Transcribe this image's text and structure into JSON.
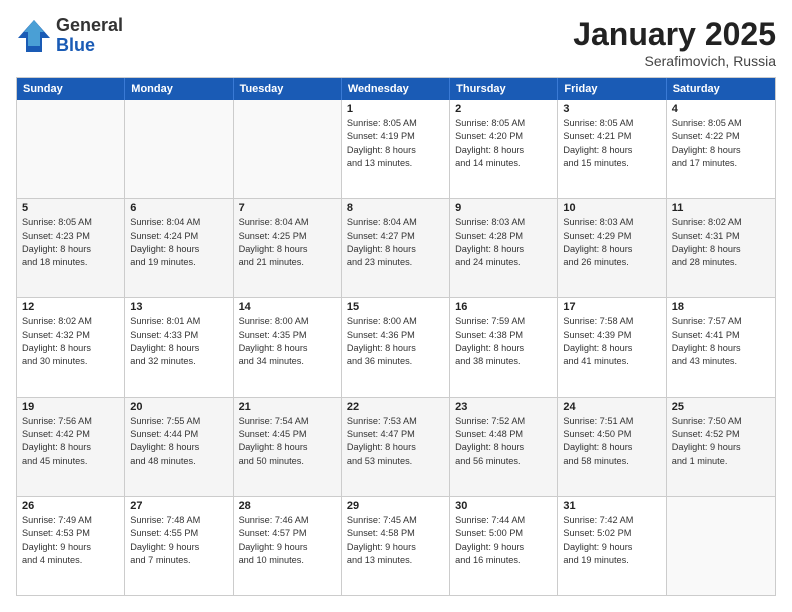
{
  "header": {
    "logo_general": "General",
    "logo_blue": "Blue",
    "month_title": "January 2025",
    "location": "Serafimovich, Russia"
  },
  "weekdays": [
    "Sunday",
    "Monday",
    "Tuesday",
    "Wednesday",
    "Thursday",
    "Friday",
    "Saturday"
  ],
  "rows": [
    [
      {
        "day": "",
        "text": "",
        "empty": true
      },
      {
        "day": "",
        "text": "",
        "empty": true
      },
      {
        "day": "",
        "text": "",
        "empty": true
      },
      {
        "day": "1",
        "text": "Sunrise: 8:05 AM\nSunset: 4:19 PM\nDaylight: 8 hours\nand 13 minutes."
      },
      {
        "day": "2",
        "text": "Sunrise: 8:05 AM\nSunset: 4:20 PM\nDaylight: 8 hours\nand 14 minutes."
      },
      {
        "day": "3",
        "text": "Sunrise: 8:05 AM\nSunset: 4:21 PM\nDaylight: 8 hours\nand 15 minutes."
      },
      {
        "day": "4",
        "text": "Sunrise: 8:05 AM\nSunset: 4:22 PM\nDaylight: 8 hours\nand 17 minutes."
      }
    ],
    [
      {
        "day": "5",
        "text": "Sunrise: 8:05 AM\nSunset: 4:23 PM\nDaylight: 8 hours\nand 18 minutes."
      },
      {
        "day": "6",
        "text": "Sunrise: 8:04 AM\nSunset: 4:24 PM\nDaylight: 8 hours\nand 19 minutes."
      },
      {
        "day": "7",
        "text": "Sunrise: 8:04 AM\nSunset: 4:25 PM\nDaylight: 8 hours\nand 21 minutes."
      },
      {
        "day": "8",
        "text": "Sunrise: 8:04 AM\nSunset: 4:27 PM\nDaylight: 8 hours\nand 23 minutes."
      },
      {
        "day": "9",
        "text": "Sunrise: 8:03 AM\nSunset: 4:28 PM\nDaylight: 8 hours\nand 24 minutes."
      },
      {
        "day": "10",
        "text": "Sunrise: 8:03 AM\nSunset: 4:29 PM\nDaylight: 8 hours\nand 26 minutes."
      },
      {
        "day": "11",
        "text": "Sunrise: 8:02 AM\nSunset: 4:31 PM\nDaylight: 8 hours\nand 28 minutes."
      }
    ],
    [
      {
        "day": "12",
        "text": "Sunrise: 8:02 AM\nSunset: 4:32 PM\nDaylight: 8 hours\nand 30 minutes."
      },
      {
        "day": "13",
        "text": "Sunrise: 8:01 AM\nSunset: 4:33 PM\nDaylight: 8 hours\nand 32 minutes."
      },
      {
        "day": "14",
        "text": "Sunrise: 8:00 AM\nSunset: 4:35 PM\nDaylight: 8 hours\nand 34 minutes."
      },
      {
        "day": "15",
        "text": "Sunrise: 8:00 AM\nSunset: 4:36 PM\nDaylight: 8 hours\nand 36 minutes."
      },
      {
        "day": "16",
        "text": "Sunrise: 7:59 AM\nSunset: 4:38 PM\nDaylight: 8 hours\nand 38 minutes."
      },
      {
        "day": "17",
        "text": "Sunrise: 7:58 AM\nSunset: 4:39 PM\nDaylight: 8 hours\nand 41 minutes."
      },
      {
        "day": "18",
        "text": "Sunrise: 7:57 AM\nSunset: 4:41 PM\nDaylight: 8 hours\nand 43 minutes."
      }
    ],
    [
      {
        "day": "19",
        "text": "Sunrise: 7:56 AM\nSunset: 4:42 PM\nDaylight: 8 hours\nand 45 minutes."
      },
      {
        "day": "20",
        "text": "Sunrise: 7:55 AM\nSunset: 4:44 PM\nDaylight: 8 hours\nand 48 minutes."
      },
      {
        "day": "21",
        "text": "Sunrise: 7:54 AM\nSunset: 4:45 PM\nDaylight: 8 hours\nand 50 minutes."
      },
      {
        "day": "22",
        "text": "Sunrise: 7:53 AM\nSunset: 4:47 PM\nDaylight: 8 hours\nand 53 minutes."
      },
      {
        "day": "23",
        "text": "Sunrise: 7:52 AM\nSunset: 4:48 PM\nDaylight: 8 hours\nand 56 minutes."
      },
      {
        "day": "24",
        "text": "Sunrise: 7:51 AM\nSunset: 4:50 PM\nDaylight: 8 hours\nand 58 minutes."
      },
      {
        "day": "25",
        "text": "Sunrise: 7:50 AM\nSunset: 4:52 PM\nDaylight: 9 hours\nand 1 minute."
      }
    ],
    [
      {
        "day": "26",
        "text": "Sunrise: 7:49 AM\nSunset: 4:53 PM\nDaylight: 9 hours\nand 4 minutes."
      },
      {
        "day": "27",
        "text": "Sunrise: 7:48 AM\nSunset: 4:55 PM\nDaylight: 9 hours\nand 7 minutes."
      },
      {
        "day": "28",
        "text": "Sunrise: 7:46 AM\nSunset: 4:57 PM\nDaylight: 9 hours\nand 10 minutes."
      },
      {
        "day": "29",
        "text": "Sunrise: 7:45 AM\nSunset: 4:58 PM\nDaylight: 9 hours\nand 13 minutes."
      },
      {
        "day": "30",
        "text": "Sunrise: 7:44 AM\nSunset: 5:00 PM\nDaylight: 9 hours\nand 16 minutes."
      },
      {
        "day": "31",
        "text": "Sunrise: 7:42 AM\nSunset: 5:02 PM\nDaylight: 9 hours\nand 19 minutes."
      },
      {
        "day": "",
        "text": "",
        "empty": true
      }
    ]
  ]
}
